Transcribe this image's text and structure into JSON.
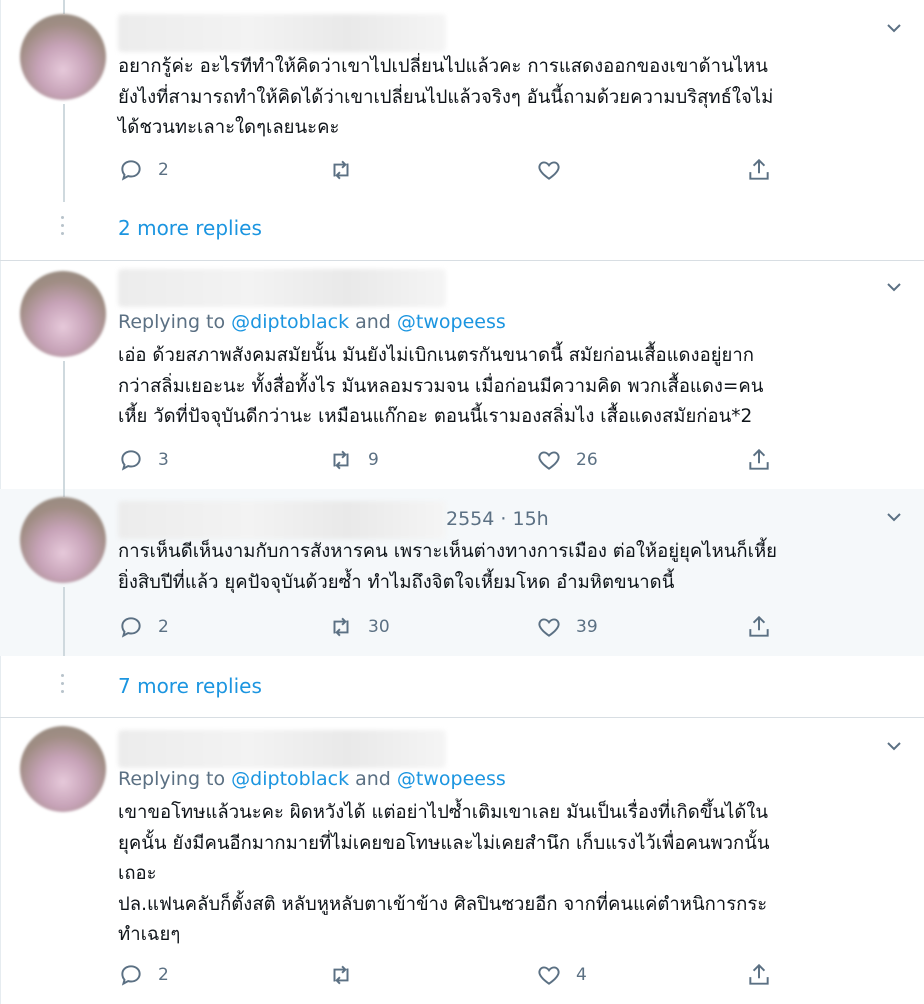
{
  "theme": {
    "link": "#1b95e0",
    "muted": "#5b7083",
    "text": "#0f1419",
    "highlight_bg": "#f5f8fa"
  },
  "tweets": [
    {
      "text": "อยากรู้ค่ะ อะไรทีทำให้คิดว่าเขาไปเปลี่ยนไปแล้วคะ การแสดงออกของเขาด้านไหน\nยังไงที่สามารถทำให้คิดได้ว่าเขาเปลี่ยนไปแล้วจริงๆ อันนี้ถามด้วยความบริสุทธ์ใจไม่\nได้ชวนทะเลาะใดๆเลยนะคะ",
      "reply_count": "2",
      "retweet_count": "",
      "like_count": ""
    },
    {
      "replying_prefix": "Replying to",
      "mention_1": "@diptoblack",
      "and_word": "and",
      "mention_2": "@twopeess",
      "text": "เอ่อ ด้วยสภาพสังคมสมัยนั้น มันยังไม่เบิกเนตรกันขนาดนี้ สมัยก่อนเสื้อแดงอยู่ยาก\nกว่าสลิ่มเยอะนะ ทั้งสื่อทั้งไร มันหลอมรวมจน เมื่อก่อนมีความคิด พวกเสื้อแดง=คน\nเหี้ย วัดที่ปัจจุบันดีกว่านะ เหมือนแก๊กอะ ตอนนี้เรามองสลิ่มไง เสื้อแดงสมัยก่อน*2",
      "reply_count": "3",
      "retweet_count": "9",
      "like_count": "26"
    },
    {
      "handle_partial": "2554",
      "time": "· 15h",
      "text": "การเห็นดีเห็นงามกับการสังหารคน เพราะเห็นต่างทางการเมือง ต่อให้อยู่ยุคไหนก็เหี้ย\nยิ่งสิบปีที่แล้ว ยุคปัจจุบันด้วยซ้ำ ทำไมถึงจิตใจเหี้ยมโหด อำมหิตขนาดนี้",
      "reply_count": "2",
      "retweet_count": "30",
      "like_count": "39"
    },
    {
      "replying_prefix": "Replying to",
      "mention_1": "@diptoblack",
      "and_word": "and",
      "mention_2": "@twopeess",
      "text": "เขาขอโทษแล้วนะคะ ผิดหวังได้ แต่อย่าไปซ้ำเติมเขาเลย มันเป็นเรื่องที่เกิดขึ้นได้ใน\nยุคนั้น ยังมีคนอีกมากมายที่ไม่เคยขอโทษและไม่เคยสำนึก เก็บแรงไว้เพื่อคนพวกนั้น\nเถอะ\nปล.แฟนคลับก็ตั้งสติ หลับหูหลับตาเข้าข้าง ศิลปินซวยอีก จากที่คนแค่ตำหนิการกระ\nทำเฉยๆ",
      "reply_count": "2",
      "retweet_count": "",
      "like_count": "4"
    }
  ],
  "more_replies": [
    {
      "label": "2 more replies"
    },
    {
      "label": "7 more replies"
    }
  ],
  "icons": {
    "reply": "reply-icon",
    "retweet": "retweet-icon",
    "like": "heart-icon",
    "share": "share-icon",
    "caret": "chevron-down-icon"
  }
}
